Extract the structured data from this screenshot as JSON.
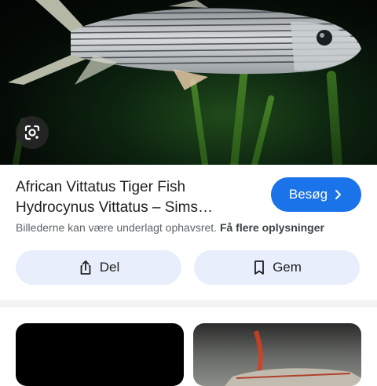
{
  "hero": {
    "image": "tiger-fish-photo",
    "lens_icon": "google-lens-icon"
  },
  "result": {
    "title_line1": "African Vittatus Tiger Fish",
    "title_line2": "Hydrocynus Vittatus – Sims…",
    "visit_label": "Besøg",
    "visit_icon": "chevron-right-icon",
    "rights_text": "Billederne kan være underlagt ophavsret.",
    "rights_link": "Få flere oplysninger"
  },
  "actions": {
    "share_label": "Del",
    "share_icon": "share-icon",
    "save_label": "Gem",
    "save_icon": "bookmark-icon"
  },
  "related": {
    "thumbnails": [
      "related-image-1",
      "related-image-2"
    ]
  },
  "colors": {
    "accent": "#1a73e8",
    "pill_bg": "#e8eefb"
  }
}
